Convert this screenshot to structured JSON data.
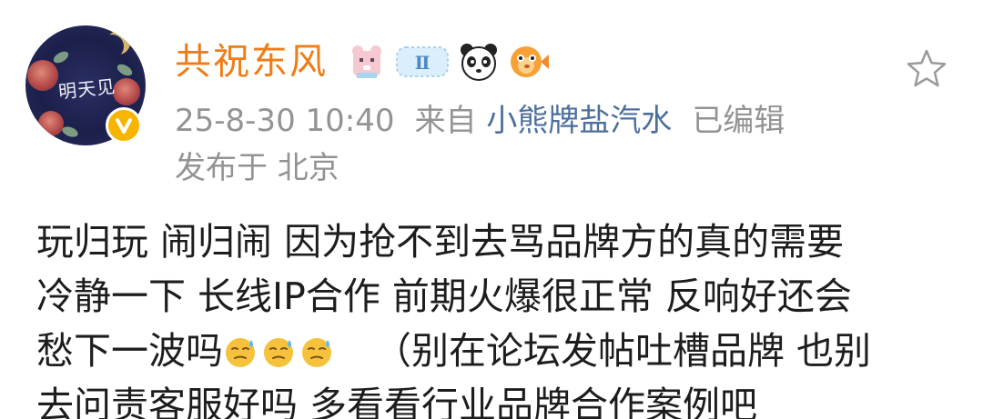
{
  "post": {
    "author": {
      "username": "共祝东风",
      "avatar_signature": "明天见",
      "verified_icon": "verified-v-icon",
      "badges": [
        "pixel-bear-badge",
        "gemini-zodiac-badge",
        "panda-emoji-badge",
        "pufferfish-badge"
      ]
    },
    "meta": {
      "timestamp": "25-8-30 10:40",
      "source_prefix": "来自",
      "source_name": "小熊牌盐汽水",
      "edited_label": "已编辑",
      "location": "发布于 北京"
    },
    "favorite_icon": "star-outline-icon",
    "content": {
      "line1": "玩归玩 闹归闹 因为抢不到去骂品牌方的真的需要",
      "line2": "冷静一下 长线IP合作 前期火爆很正常 反响好还会",
      "line3_text": "愁下一波吗",
      "line3_emoji": "sweat-smile-emoji",
      "line3_tail": "（别在论坛发帖吐槽品牌 也别",
      "line4": "去问责客服好吗 多看看行业品牌合作案例吧"
    }
  },
  "colors": {
    "username": "#f07c16",
    "meta_gray": "#939393",
    "source_link": "#4d6f9c",
    "body_text": "#1d1d1d",
    "verified": "#f7b500"
  }
}
